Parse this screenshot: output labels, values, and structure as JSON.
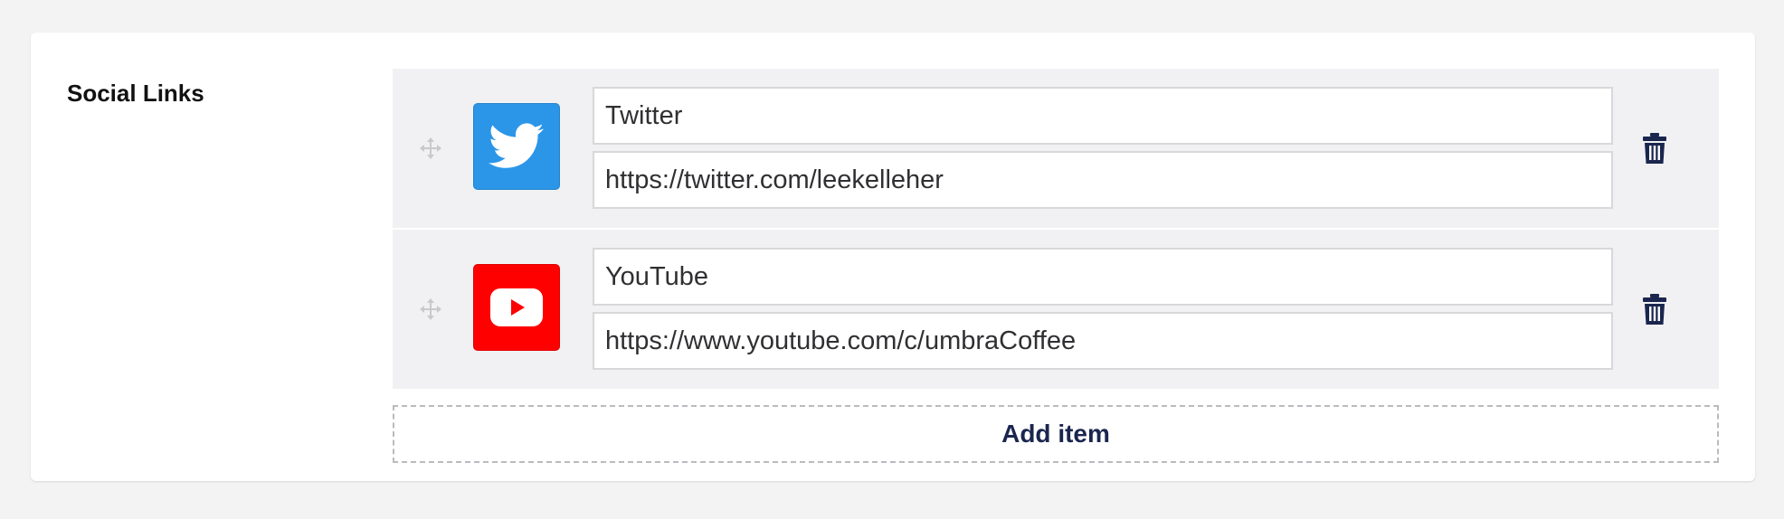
{
  "property": {
    "label": "Social Links"
  },
  "items": [
    {
      "name": "Twitter",
      "url": "https://twitter.com/leekelleher",
      "icon": "twitter-icon",
      "icon_bg": "#2b96e8"
    },
    {
      "name": "YouTube",
      "url": "https://www.youtube.com/c/umbraCoffee",
      "icon": "youtube-icon",
      "icon_bg": "#ff0000"
    }
  ],
  "actions": {
    "add_item_label": "Add item"
  },
  "colors": {
    "page_bg": "#f4f3f4",
    "row_bg": "#f1f1f3",
    "accent_text": "#1b264f"
  }
}
